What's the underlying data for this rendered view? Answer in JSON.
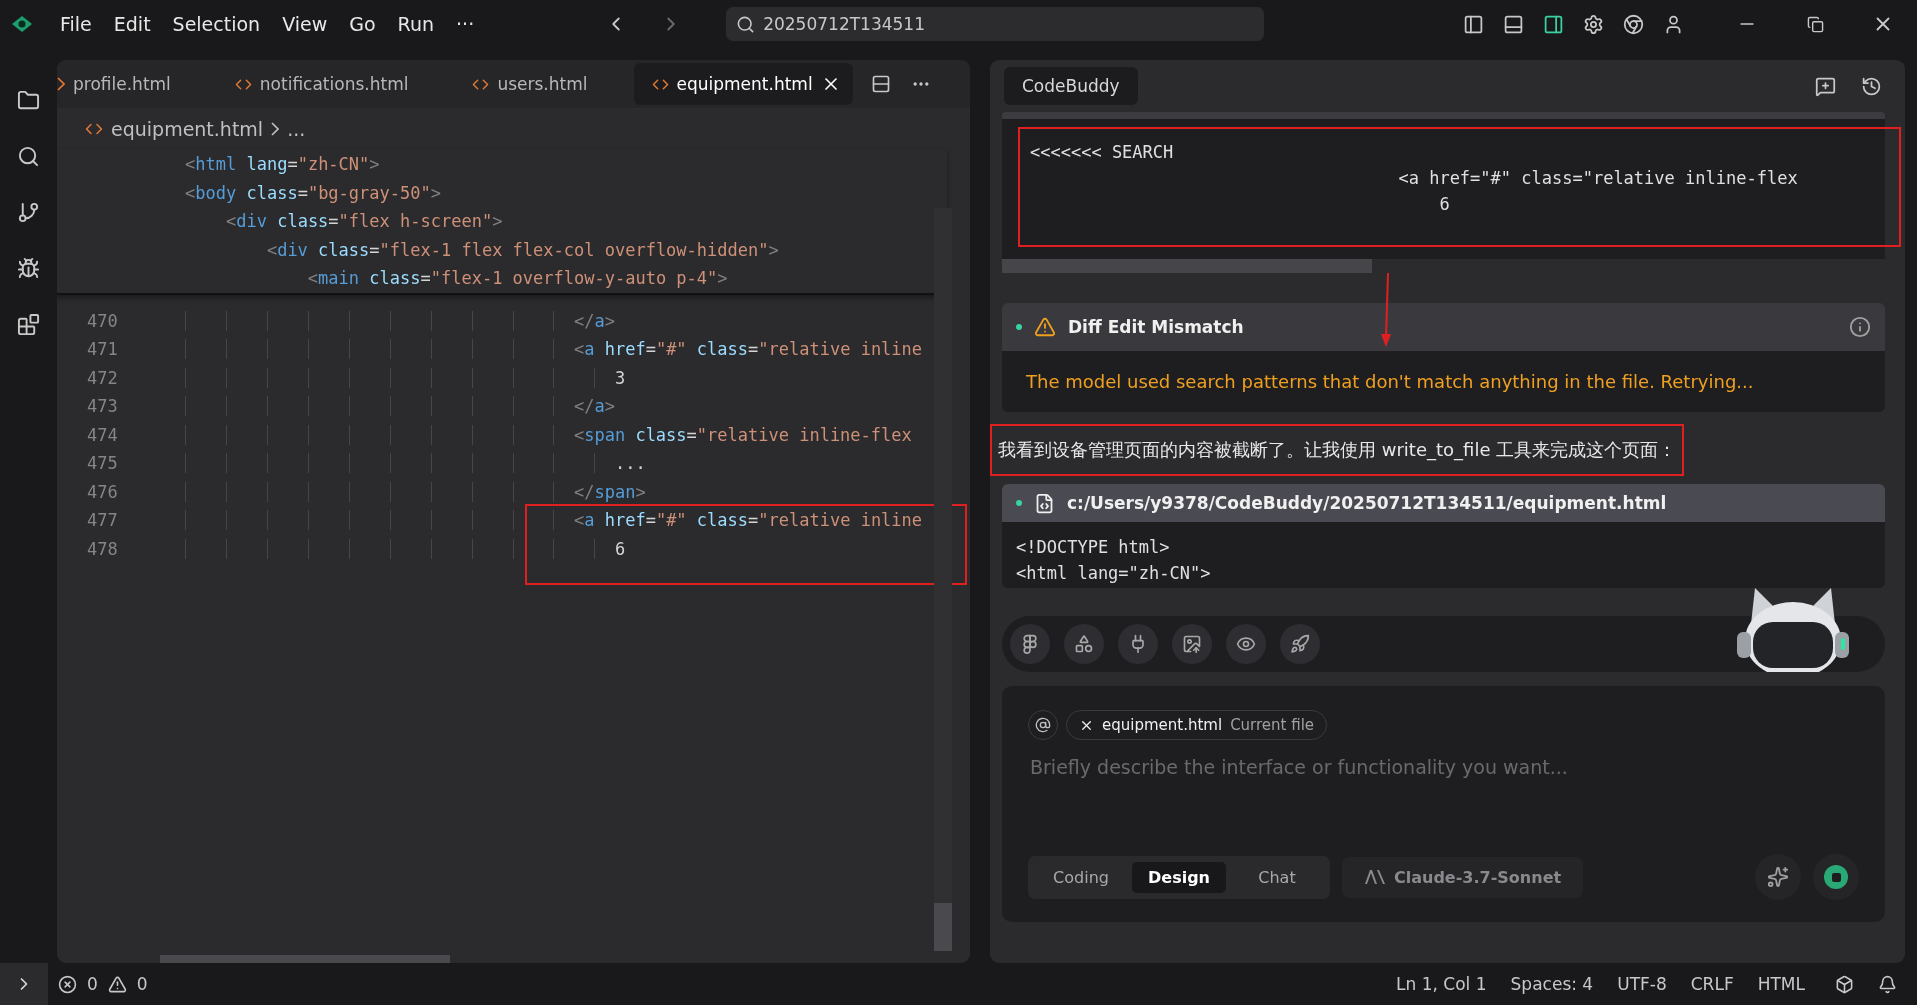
{
  "title_bar": {
    "menu": [
      "File",
      "Edit",
      "Selection",
      "View",
      "Go",
      "Run"
    ],
    "more": "···",
    "search": "20250712T134511"
  },
  "editor": {
    "tabs": [
      {
        "label": "profile.html",
        "selected": false
      },
      {
        "label": "notifications.html",
        "selected": false
      },
      {
        "label": "users.html",
        "selected": false
      },
      {
        "label": "equipment.html",
        "selected": true
      }
    ],
    "breadcrumb": [
      "equipment.html",
      "..."
    ],
    "sticky_lines": [
      "<html lang=\"zh-CN\">",
      "<body class=\"bg-gray-50\">",
      "    <div class=\"flex h-screen\">",
      "        <div class=\"flex-1 flex flex-col overflow-hidden\">",
      "            <main class=\"flex-1 overflow-y-auto p-4\">"
    ],
    "lines": [
      {
        "number": "470",
        "text": "                                      </a>"
      },
      {
        "number": "471",
        "text": "                                      <a href=\"#\" class=\"relative inline"
      },
      {
        "number": "472",
        "text": "                                          3"
      },
      {
        "number": "473",
        "text": "                                      </a>"
      },
      {
        "number": "474",
        "text": "                                      <span class=\"relative inline-flex"
      },
      {
        "number": "475",
        "text": "                                          ..."
      },
      {
        "number": "476",
        "text": "                                      </span>"
      }
    ],
    "framed_lines": [
      {
        "number": "477",
        "text": "                                      <a href=\"#\" class=\"relative inline"
      },
      {
        "number": "478",
        "text": "                                          6"
      }
    ]
  },
  "assistant": {
    "title": "CodeBuddy",
    "search_block": {
      "highlighted": true,
      "lines": [
        "<<<<<<< SEARCH",
        "                                    <a href=\"#\" class=\"relative inline-flex",
        "                                        6"
      ]
    },
    "alert": {
      "title": "Diff Edit Mismatch",
      "message": "The model used search patterns that don't match anything in the file. Retrying..."
    },
    "message": {
      "text": "我看到设备管理页面的内容被截断了。让我使用 write_to_file 工具来完成这个页面：",
      "highlighted": true
    },
    "file_card": {
      "path": "c:/Users/y9378/CodeBuddy/20250712T134511/equipment.html",
      "lines": [
        "<!DOCTYPE html>",
        "<html lang=\"zh-CN\">"
      ]
    },
    "input": {
      "context_file": "equipment.html",
      "context_note": "Current file",
      "placeholder": "Briefly describe the interface or functionality you want...",
      "modes": [
        {
          "label": "Coding",
          "selected": false
        },
        {
          "label": "Design",
          "selected": true
        },
        {
          "label": "Chat",
          "selected": false
        }
      ],
      "model": "Claude-3.7-Sonnet"
    }
  },
  "status_bar": {
    "errors": "0",
    "warnings": "0",
    "items": [
      "Ln 1, Col 1",
      "Spaces: 4",
      "UTF-8",
      "CRLF",
      "HTML"
    ]
  }
}
